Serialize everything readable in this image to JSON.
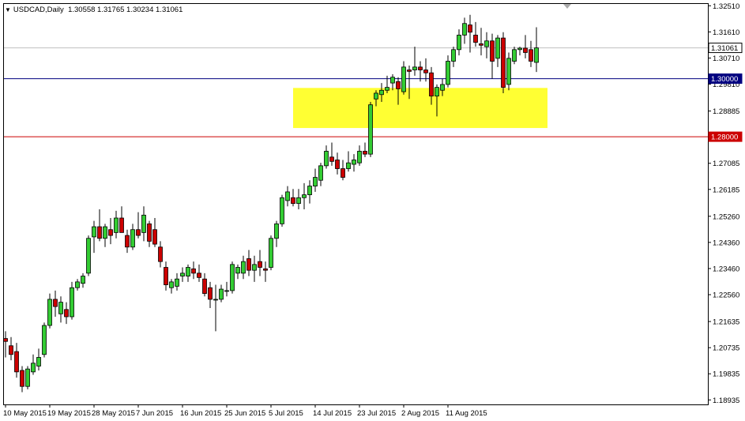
{
  "header": {
    "symbol": "USDCAD,Daily",
    "ohlc": "1.30558 1.31765 1.30234 1.31061"
  },
  "colors": {
    "background": "#ffffff",
    "axis": "#000000",
    "bull_candle": "#33cc33",
    "bear_candle": "#cc0000",
    "zone_fill": "#ffff33",
    "blue_line": "#000080",
    "red_line": "#cc0000",
    "current_price_line": "#c0c0c0"
  },
  "chart_data": {
    "type": "candlestick",
    "title": "USDCAD,Daily",
    "ylim": [
      1.1878,
      1.326
    ],
    "y_ticks": [
      "1.32510",
      "1.31610",
      "1.30710",
      "1.29810",
      "1.28885",
      "1.27985",
      "1.27085",
      "1.26185",
      "1.25260",
      "1.24360",
      "1.23460",
      "1.22560",
      "1.21635",
      "1.20735",
      "1.19835",
      "1.18935"
    ],
    "x_ticks": [
      "10 May 2015",
      "19 May 2015",
      "28 May 2015",
      "7 Jun 2015",
      "16 Jun 2015",
      "25 Jun 2015",
      "5 Jul 2015",
      "14 Jul 2015",
      "23 Jul 2015",
      "2 Aug 2015",
      "11 Aug 2015"
    ],
    "x_tick_index": [
      0,
      8,
      16,
      24,
      32,
      40,
      48,
      56,
      64,
      72,
      80
    ],
    "horizontal_lines": [
      {
        "label": "1.30000",
        "value": 1.3,
        "color": "#000080"
      },
      {
        "label": "1.28000",
        "value": 1.28,
        "color": "#cc0000"
      }
    ],
    "current_price": {
      "label": "1.31061",
      "value": 1.31061
    },
    "zone": {
      "from_index": 52,
      "to_index": 98,
      "low": 1.283,
      "high": 1.2968
    },
    "candles": [
      {
        "o": 1.2105,
        "h": 1.213,
        "l": 1.204,
        "c": 1.2095
      },
      {
        "o": 1.208,
        "h": 1.211,
        "l": 1.203,
        "c": 1.205
      },
      {
        "o": 1.206,
        "h": 1.209,
        "l": 1.197,
        "c": 1.199
      },
      {
        "o": 1.1995,
        "h": 1.201,
        "l": 1.192,
        "c": 1.194
      },
      {
        "o": 1.194,
        "h": 1.201,
        "l": 1.193,
        "c": 1.2
      },
      {
        "o": 1.199,
        "h": 1.205,
        "l": 1.198,
        "c": 1.202
      },
      {
        "o": 1.201,
        "h": 1.207,
        "l": 1.1995,
        "c": 1.204
      },
      {
        "o": 1.205,
        "h": 1.216,
        "l": 1.204,
        "c": 1.215
      },
      {
        "o": 1.215,
        "h": 1.226,
        "l": 1.214,
        "c": 1.224
      },
      {
        "o": 1.224,
        "h": 1.227,
        "l": 1.218,
        "c": 1.2215
      },
      {
        "o": 1.219,
        "h": 1.225,
        "l": 1.216,
        "c": 1.223
      },
      {
        "o": 1.2205,
        "h": 1.223,
        "l": 1.2155,
        "c": 1.218
      },
      {
        "o": 1.218,
        "h": 1.23,
        "l": 1.217,
        "c": 1.228
      },
      {
        "o": 1.228,
        "h": 1.231,
        "l": 1.227,
        "c": 1.23
      },
      {
        "o": 1.2295,
        "h": 1.233,
        "l": 1.228,
        "c": 1.232
      },
      {
        "o": 1.233,
        "h": 1.246,
        "l": 1.232,
        "c": 1.245
      },
      {
        "o": 1.2455,
        "h": 1.251,
        "l": 1.24,
        "c": 1.249
      },
      {
        "o": 1.249,
        "h": 1.255,
        "l": 1.244,
        "c": 1.245
      },
      {
        "o": 1.245,
        "h": 1.25,
        "l": 1.242,
        "c": 1.249
      },
      {
        "o": 1.248,
        "h": 1.252,
        "l": 1.243,
        "c": 1.246
      },
      {
        "o": 1.247,
        "h": 1.2545,
        "l": 1.245,
        "c": 1.252
      },
      {
        "o": 1.252,
        "h": 1.256,
        "l": 1.248,
        "c": 1.247
      },
      {
        "o": 1.246,
        "h": 1.248,
        "l": 1.24,
        "c": 1.242
      },
      {
        "o": 1.242,
        "h": 1.25,
        "l": 1.241,
        "c": 1.248
      },
      {
        "o": 1.248,
        "h": 1.254,
        "l": 1.245,
        "c": 1.246
      },
      {
        "o": 1.247,
        "h": 1.256,
        "l": 1.244,
        "c": 1.253
      },
      {
        "o": 1.25,
        "h": 1.251,
        "l": 1.242,
        "c": 1.244
      },
      {
        "o": 1.248,
        "h": 1.252,
        "l": 1.242,
        "c": 1.243
      },
      {
        "o": 1.242,
        "h": 1.244,
        "l": 1.235,
        "c": 1.237
      },
      {
        "o": 1.235,
        "h": 1.237,
        "l": 1.227,
        "c": 1.229
      },
      {
        "o": 1.228,
        "h": 1.231,
        "l": 1.226,
        "c": 1.23
      },
      {
        "o": 1.2285,
        "h": 1.233,
        "l": 1.227,
        "c": 1.231
      },
      {
        "o": 1.232,
        "h": 1.235,
        "l": 1.23,
        "c": 1.233
      },
      {
        "o": 1.232,
        "h": 1.236,
        "l": 1.23,
        "c": 1.235
      },
      {
        "o": 1.2345,
        "h": 1.237,
        "l": 1.231,
        "c": 1.233
      },
      {
        "o": 1.233,
        "h": 1.236,
        "l": 1.23,
        "c": 1.2315
      },
      {
        "o": 1.231,
        "h": 1.233,
        "l": 1.225,
        "c": 1.226
      },
      {
        "o": 1.228,
        "h": 1.23,
        "l": 1.221,
        "c": 1.224
      },
      {
        "o": 1.224,
        "h": 1.229,
        "l": 1.213,
        "c": 1.224
      },
      {
        "o": 1.224,
        "h": 1.229,
        "l": 1.223,
        "c": 1.2275
      },
      {
        "o": 1.227,
        "h": 1.23,
        "l": 1.225,
        "c": 1.227
      },
      {
        "o": 1.227,
        "h": 1.237,
        "l": 1.226,
        "c": 1.236
      },
      {
        "o": 1.233,
        "h": 1.236,
        "l": 1.231,
        "c": 1.235
      },
      {
        "o": 1.233,
        "h": 1.239,
        "l": 1.231,
        "c": 1.237
      },
      {
        "o": 1.238,
        "h": 1.241,
        "l": 1.232,
        "c": 1.234
      },
      {
        "o": 1.234,
        "h": 1.239,
        "l": 1.23,
        "c": 1.236
      },
      {
        "o": 1.237,
        "h": 1.241,
        "l": 1.232,
        "c": 1.235
      },
      {
        "o": 1.2345,
        "h": 1.237,
        "l": 1.23,
        "c": 1.234
      },
      {
        "o": 1.235,
        "h": 1.246,
        "l": 1.234,
        "c": 1.245
      },
      {
        "o": 1.245,
        "h": 1.251,
        "l": 1.242,
        "c": 1.25
      },
      {
        "o": 1.25,
        "h": 1.26,
        "l": 1.249,
        "c": 1.259
      },
      {
        "o": 1.258,
        "h": 1.263,
        "l": 1.256,
        "c": 1.261
      },
      {
        "o": 1.259,
        "h": 1.262,
        "l": 1.256,
        "c": 1.257
      },
      {
        "o": 1.257,
        "h": 1.262,
        "l": 1.255,
        "c": 1.259
      },
      {
        "o": 1.259,
        "h": 1.264,
        "l": 1.255,
        "c": 1.26
      },
      {
        "o": 1.26,
        "h": 1.265,
        "l": 1.257,
        "c": 1.263
      },
      {
        "o": 1.263,
        "h": 1.269,
        "l": 1.261,
        "c": 1.266
      },
      {
        "o": 1.265,
        "h": 1.271,
        "l": 1.263,
        "c": 1.27
      },
      {
        "o": 1.27,
        "h": 1.277,
        "l": 1.269,
        "c": 1.275
      },
      {
        "o": 1.273,
        "h": 1.278,
        "l": 1.27,
        "c": 1.2715
      },
      {
        "o": 1.272,
        "h": 1.2745,
        "l": 1.267,
        "c": 1.269
      },
      {
        "o": 1.269,
        "h": 1.272,
        "l": 1.265,
        "c": 1.266
      },
      {
        "o": 1.269,
        "h": 1.275,
        "l": 1.268,
        "c": 1.271
      },
      {
        "o": 1.2705,
        "h": 1.274,
        "l": 1.268,
        "c": 1.272
      },
      {
        "o": 1.271,
        "h": 1.277,
        "l": 1.27,
        "c": 1.275
      },
      {
        "o": 1.275,
        "h": 1.278,
        "l": 1.273,
        "c": 1.274
      },
      {
        "o": 1.274,
        "h": 1.292,
        "l": 1.273,
        "c": 1.291
      },
      {
        "o": 1.293,
        "h": 1.296,
        "l": 1.2905,
        "c": 1.295
      },
      {
        "o": 1.2945,
        "h": 1.2985,
        "l": 1.292,
        "c": 1.296
      },
      {
        "o": 1.296,
        "h": 1.301,
        "l": 1.295,
        "c": 1.297
      },
      {
        "o": 1.2985,
        "h": 1.3015,
        "l": 1.296,
        "c": 1.3005
      },
      {
        "o": 1.299,
        "h": 1.3005,
        "l": 1.291,
        "c": 1.2965
      },
      {
        "o": 1.2955,
        "h": 1.306,
        "l": 1.2945,
        "c": 1.304
      },
      {
        "o": 1.303,
        "h": 1.3045,
        "l": 1.293,
        "c": 1.3025
      },
      {
        "o": 1.303,
        "h": 1.311,
        "l": 1.301,
        "c": 1.304
      },
      {
        "o": 1.304,
        "h": 1.306,
        "l": 1.299,
        "c": 1.303
      },
      {
        "o": 1.303,
        "h": 1.307,
        "l": 1.299,
        "c": 1.302
      },
      {
        "o": 1.302,
        "h": 1.304,
        "l": 1.291,
        "c": 1.294
      },
      {
        "o": 1.294,
        "h": 1.298,
        "l": 1.287,
        "c": 1.297
      },
      {
        "o": 1.296,
        "h": 1.3,
        "l": 1.294,
        "c": 1.298
      },
      {
        "o": 1.298,
        "h": 1.308,
        "l": 1.297,
        "c": 1.306
      },
      {
        "o": 1.306,
        "h": 1.311,
        "l": 1.304,
        "c": 1.31
      },
      {
        "o": 1.31,
        "h": 1.317,
        "l": 1.308,
        "c": 1.315
      },
      {
        "o": 1.315,
        "h": 1.321,
        "l": 1.312,
        "c": 1.319
      },
      {
        "o": 1.3185,
        "h": 1.322,
        "l": 1.309,
        "c": 1.316
      },
      {
        "o": 1.315,
        "h": 1.3195,
        "l": 1.311,
        "c": 1.3125
      },
      {
        "o": 1.312,
        "h": 1.3175,
        "l": 1.308,
        "c": 1.3115
      },
      {
        "o": 1.311,
        "h": 1.316,
        "l": 1.307,
        "c": 1.313
      },
      {
        "o": 1.313,
        "h": 1.3155,
        "l": 1.3,
        "c": 1.306
      },
      {
        "o": 1.307,
        "h": 1.315,
        "l": 1.304,
        "c": 1.314
      },
      {
        "o": 1.314,
        "h": 1.316,
        "l": 1.295,
        "c": 1.297
      },
      {
        "o": 1.298,
        "h": 1.309,
        "l": 1.296,
        "c": 1.307
      },
      {
        "o": 1.306,
        "h": 1.311,
        "l": 1.305,
        "c": 1.31
      },
      {
        "o": 1.31,
        "h": 1.311,
        "l": 1.308,
        "c": 1.3105
      },
      {
        "o": 1.3105,
        "h": 1.315,
        "l": 1.307,
        "c": 1.309
      },
      {
        "o": 1.31,
        "h": 1.313,
        "l": 1.304,
        "c": 1.306
      },
      {
        "o": 1.3056,
        "h": 1.3177,
        "l": 1.3023,
        "c": 1.3106
      }
    ]
  }
}
